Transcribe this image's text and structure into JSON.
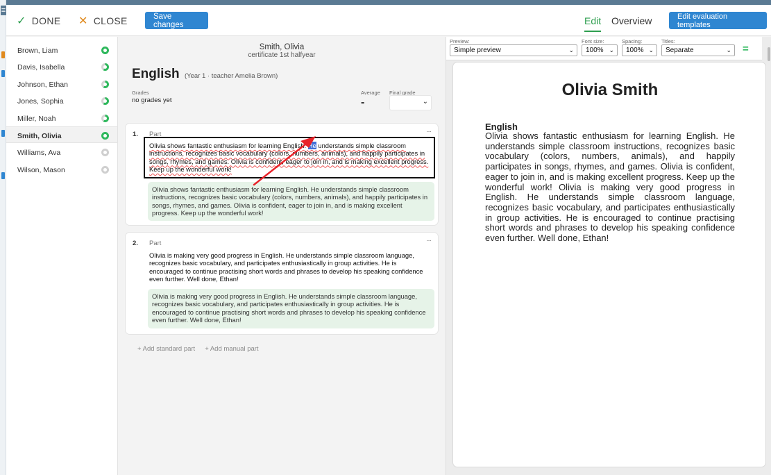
{
  "toolbar": {
    "done_label": "DONE",
    "close_label": "CLOSE",
    "save_label": "Save changes",
    "tab_edit": "Edit",
    "tab_overview": "Overview",
    "templates_label": "Edit evaluation templates"
  },
  "students": [
    {
      "name": "Brown, Liam",
      "status": "complete"
    },
    {
      "name": "Davis, Isabella",
      "status": "partial"
    },
    {
      "name": "Johnson, Ethan",
      "status": "partial"
    },
    {
      "name": "Jones, Sophia",
      "status": "partial"
    },
    {
      "name": "Miller, Noah",
      "status": "partial"
    },
    {
      "name": "Smith, Olivia",
      "status": "complete"
    },
    {
      "name": "Williams, Ava",
      "status": "empty"
    },
    {
      "name": "Wilson, Mason",
      "status": "empty"
    }
  ],
  "selected_student": "Smith, Olivia",
  "editor": {
    "student_name": "Smith, Olivia",
    "certificate": "certificate 1st halfyear",
    "subject": "English",
    "subject_info": "(Year 1 · teacher Amelia Brown)",
    "grades_label": "Grades",
    "grades_value": "no grades yet",
    "average_label": "Average",
    "average_value": "-",
    "final_grade_label": "Final grade",
    "final_grade_value": "",
    "parts": [
      {
        "number": "1.",
        "title": "Part",
        "more": "···",
        "text_before": "Olivia shows fantastic enthusiasm for learning English. ",
        "text_selected": "He",
        "text_after": " understands simple classroom instructions, recognizes basic vocabulary (colors, numbers, animals), and happily participates in songs, rhymes, and games. Olivia is confident, eager to join in, and is making excellent progress. Keep up the wonderful work!",
        "suggestion": "Olivia shows fantastic enthusiasm for learning English. He understands simple classroom instructions, recognizes basic vocabulary (colors, numbers, animals), and happily participates in songs, rhymes, and games. Olivia is confident, eager to join in, and is making excellent progress. Keep up the wonderful work!"
      },
      {
        "number": "2.",
        "title": "Part",
        "more": "···",
        "text": "Olivia is making very good progress in English. He understands simple classroom language, recognizes basic vocabulary, and participates enthusiastically in group activities. He is encouraged to continue practising short words and phrases to develop his speaking confidence even further. Well done, Ethan!",
        "suggestion": "Olivia is making very good progress in English. He understands simple classroom language, recognizes basic vocabulary, and participates enthusiastically in group activities. He is encouraged to continue practising short words and phrases to develop his speaking confidence even further. Well done, Ethan!"
      }
    ],
    "add_standard": "+ Add standard part",
    "add_manual": "+ Add manual part"
  },
  "preview": {
    "preview_label": "Preview:",
    "preview_value": "Simple preview",
    "font_size_label": "Font size:",
    "font_size_value": "100%",
    "spacing_label": "Spacing:",
    "spacing_value": "100%",
    "titles_label": "Titles:",
    "titles_value": "Separate",
    "menu_icon": "=",
    "title": "Olivia Smith",
    "subject": "English",
    "body": "Olivia shows fantastic enthusiasm for learning English. He understands simple classroom instructions, recognizes basic vocabulary (colors, numbers, animals), and happily participates in songs, rhymes, and games. Olivia is confident, eager to join in, and is making excellent progress. Keep up the wonderful work! Olivia is making very good progress in English. He understands simple classroom language, recognizes basic vocabulary, and participates enthusiastically in group activities. He is encouraged to continue practising short words and phrases to develop his speaking confidence even further. Well done, Ethan!"
  },
  "colors": {
    "accent_green": "#2e9e4f",
    "primary_blue": "#2f86d1",
    "close_orange": "#e08a1e",
    "arrow_red": "#e8232a",
    "selection_blue": "#3f6fd8"
  }
}
